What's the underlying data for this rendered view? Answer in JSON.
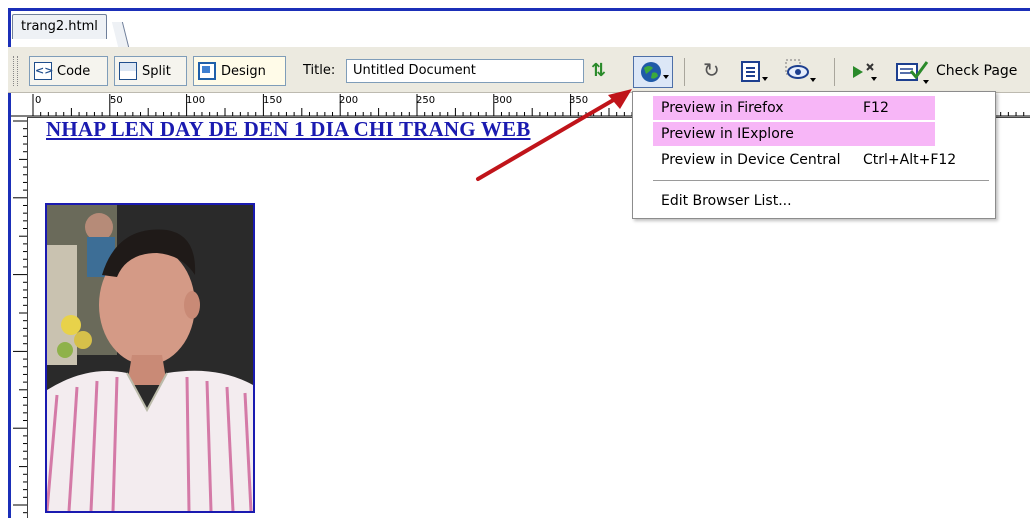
{
  "tab": {
    "filename": "trang2.html"
  },
  "toolbar": {
    "code_label": "Code",
    "split_label": "Split",
    "design_label": "Design",
    "title_label": "Title:",
    "title_value": "Untitled Document",
    "check_page_label": "Check Page"
  },
  "ruler": {
    "ticks": [
      "0",
      "50",
      "100",
      "150",
      "200",
      "250",
      "300",
      "350"
    ]
  },
  "content": {
    "link_text": "NHAP LEN DAY DE DEN 1 DIA CHI TRANG WEB"
  },
  "menu": {
    "items": [
      {
        "label": "Preview in Firefox",
        "shortcut": "F12"
      },
      {
        "label": "Preview in IExplore",
        "shortcut": ""
      },
      {
        "label": "Preview in Device Central",
        "shortcut": "Ctrl+Alt+F12"
      },
      {
        "label": "Edit Browser List...",
        "shortcut": ""
      }
    ]
  },
  "colors": {
    "highlight": "#f7b6f7",
    "arrow": "#c0141a",
    "link": "#1a1ab0",
    "tab_bar": "#8aa0bf"
  }
}
